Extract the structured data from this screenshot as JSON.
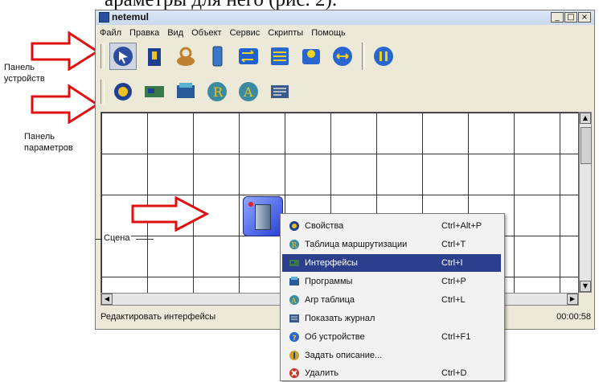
{
  "doc_text": "араметры для него (рис. 2).",
  "window": {
    "title": "netemul",
    "buttons": [
      "_",
      "□",
      "×"
    ]
  },
  "menu": [
    "Файл",
    "Правка",
    "Вид",
    "Объект",
    "Сервис",
    "Скрипты",
    "Помощь"
  ],
  "toolbar_devices": [
    "cursor-icon",
    "cable-icon",
    "hub-icon",
    "computer-icon",
    "switch-icon",
    "router-icon",
    "wifi-ap-icon",
    "swap-icon",
    "pause-icon"
  ],
  "toolbar_params": [
    "settings-icon",
    "nic-icon",
    "programs-icon",
    "routing-table-icon",
    "arp-icon",
    "journal-icon"
  ],
  "annotations": {
    "devices_panel": [
      "Панель",
      "устройств"
    ],
    "params_panel": [
      "Панель",
      "параметров"
    ],
    "scene": "Сцена"
  },
  "status": {
    "text": "Редактировать интерфейсы",
    "time": "00:00:58"
  },
  "context_menu": [
    {
      "label": "Свойства",
      "shortcut": "Ctrl+Alt+P",
      "icon": "properties-icon"
    },
    {
      "label": "Таблица маршрутизации",
      "shortcut": "Ctrl+T",
      "icon": "routing-table-icon"
    },
    {
      "label": "Интерфейсы",
      "shortcut": "Ctrl+I",
      "icon": "interfaces-icon",
      "selected": true
    },
    {
      "label": "Программы",
      "shortcut": "Ctrl+P",
      "icon": "programs-icon"
    },
    {
      "label": "Arp таблица",
      "shortcut": "Ctrl+L",
      "icon": "arp-icon"
    },
    {
      "label": "Показать журнал",
      "shortcut": "",
      "icon": "journal-icon"
    },
    {
      "label": "Об устройстве",
      "shortcut": "Ctrl+F1",
      "icon": "about-icon"
    },
    {
      "label": "Задать описание...",
      "shortcut": "",
      "icon": "description-icon"
    },
    {
      "label": "Удалить",
      "shortcut": "Ctrl+D",
      "icon": "delete-icon"
    }
  ],
  "colors": {
    "selection": "#2c3f8c",
    "arrow": "#e01010",
    "window_bg": "#ece9d8"
  }
}
